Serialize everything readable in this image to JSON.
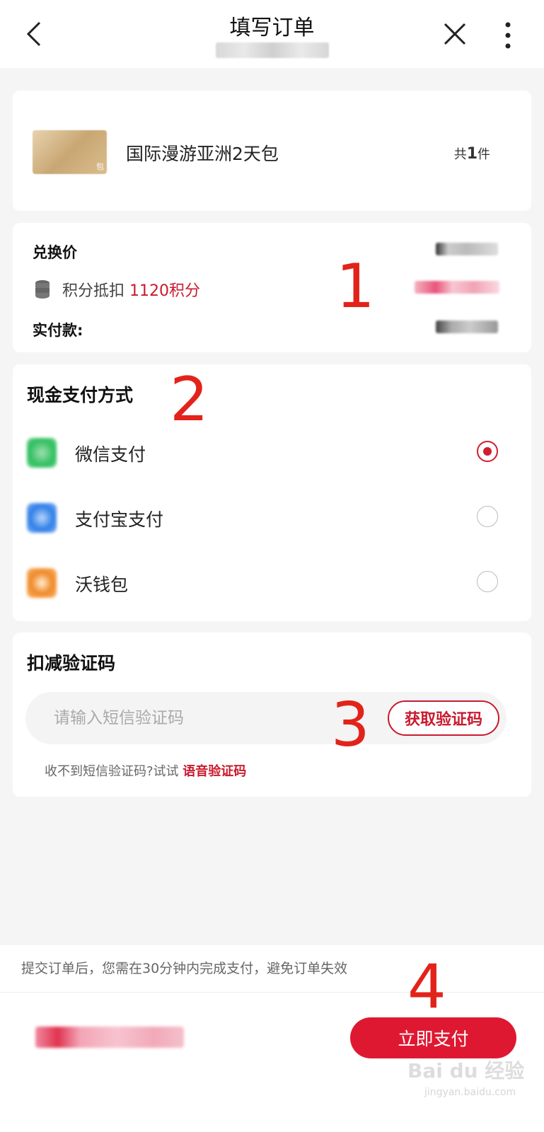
{
  "header": {
    "title": "填写订单",
    "back_icon": "chevron-left-icon",
    "close_icon": "close-icon",
    "more_icon": "more-vertical-icon"
  },
  "product": {
    "thumb_tag": "包",
    "name": "国际漫游亚洲2天包",
    "count_prefix": "共",
    "count_value": "1",
    "count_suffix": "件"
  },
  "price": {
    "exchange_label": "兑换价",
    "points_label": "积分抵扣",
    "points_value": "1120积分",
    "actual_label": "实付款:"
  },
  "payment": {
    "title": "现金支付方式",
    "methods": [
      {
        "label": "微信支付",
        "icon": "wechat-pay-icon",
        "selected": true
      },
      {
        "label": "支付宝支付",
        "icon": "alipay-icon",
        "selected": false
      },
      {
        "label": "沃钱包",
        "icon": "wo-wallet-icon",
        "selected": false
      }
    ]
  },
  "verify": {
    "title": "扣减验证码",
    "placeholder": "请输入短信验证码",
    "get_code": "获取验证码",
    "hint": "收不到短信验证码?试试",
    "voice_link": "语音验证码"
  },
  "notice": "提交订单后，您需在30分钟内完成支付，避免订单失效",
  "footer": {
    "pay_button": "立即支付"
  },
  "annotations": [
    "1",
    "2",
    "3",
    "4"
  ],
  "watermark": {
    "main": "Bai du 经验",
    "sub": "jingyan.baidu.com"
  },
  "colors": {
    "accent": "#df1832",
    "link": "#c81b2e",
    "annotation": "#e2231a"
  }
}
